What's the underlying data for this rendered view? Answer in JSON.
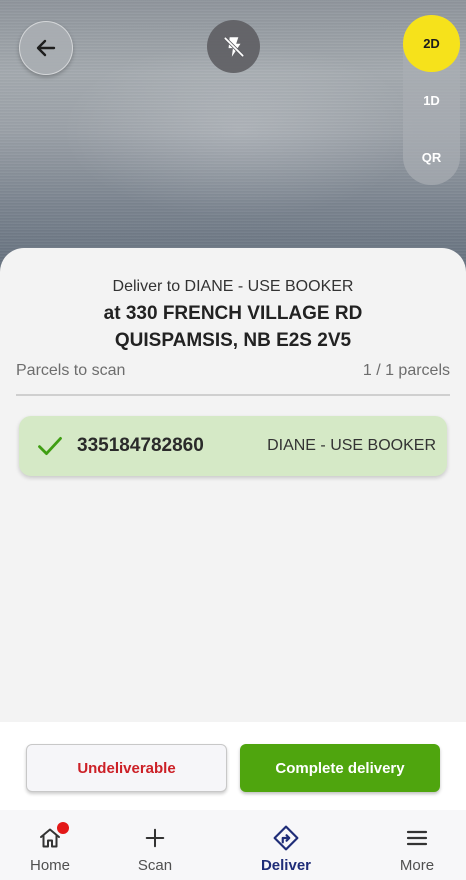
{
  "camera": {
    "modes": [
      {
        "label": "2D",
        "active": true
      },
      {
        "label": "1D",
        "active": false
      },
      {
        "label": "QR",
        "active": false
      }
    ],
    "back_icon": "arrow-left-icon",
    "flash_icon": "flash-off-icon"
  },
  "delivery": {
    "deliver_to": "Deliver to DIANE - USE BOOKER",
    "address_line1": "at 330 FRENCH VILLAGE RD",
    "address_line2": "QUISPAMSIS, NB E2S 2V5",
    "parcels_label": "Parcels to scan",
    "parcels_count": "1 / 1 parcels"
  },
  "parcels": [
    {
      "id": "335184782860",
      "recipient": "DIANE - USE BOOKER",
      "status": "scanned"
    }
  ],
  "actions": {
    "undeliverable_label": "Undeliverable",
    "complete_label": "Complete delivery"
  },
  "nav": {
    "items": [
      {
        "label": "Home",
        "icon": "home-icon",
        "badge": true
      },
      {
        "label": "Scan",
        "icon": "plus-icon",
        "badge": false
      },
      {
        "label": "Deliver",
        "icon": "deliver-route-icon",
        "active": true
      },
      {
        "label": "More",
        "icon": "menu-icon",
        "badge": false
      }
    ]
  },
  "colors": {
    "accent_yellow": "#f6e21b",
    "success_green": "#4fa50e",
    "scanned_bg": "#d5e9c6",
    "danger_red": "#cc2027",
    "nav_active": "#1f2d78",
    "badge_red": "#e31818"
  }
}
